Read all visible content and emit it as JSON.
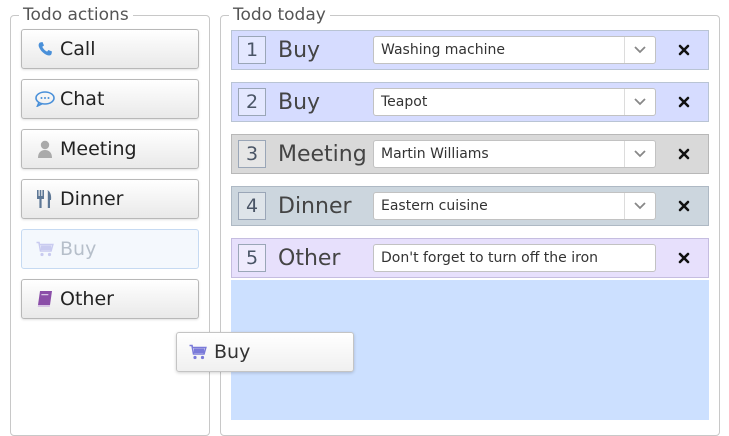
{
  "panels": {
    "actions_title": "Todo actions",
    "today_title": "Todo today"
  },
  "actions": [
    {
      "label": "Call",
      "icon": "phone-icon",
      "color": "#4a90d9"
    },
    {
      "label": "Chat",
      "icon": "speech-bubble-icon",
      "color": "#4a90d9"
    },
    {
      "label": "Meeting",
      "icon": "person-icon",
      "color": "#aaaaaa"
    },
    {
      "label": "Dinner",
      "icon": "fork-knife-icon",
      "color": "#5e7896"
    },
    {
      "label": "Buy",
      "icon": "shopping-cart-icon",
      "color": "#7a7ad9",
      "state": "dragging"
    },
    {
      "label": "Other",
      "icon": "book-icon",
      "color": "#8b4ea8"
    }
  ],
  "todos": [
    {
      "number": "1",
      "kind": "Buy",
      "value": "Washing machine",
      "control": "select",
      "bg": "#d6dcff"
    },
    {
      "number": "2",
      "kind": "Buy",
      "value": "Teapot",
      "control": "select",
      "bg": "#d6dcff"
    },
    {
      "number": "3",
      "kind": "Meeting",
      "value": "Martin Williams",
      "control": "select",
      "bg": "#d9d9d9"
    },
    {
      "number": "4",
      "kind": "Dinner",
      "value": "Eastern cuisine",
      "control": "select",
      "bg": "#ccd6de"
    },
    {
      "number": "5",
      "kind": "Other",
      "value": "Don't forget to turn off the iron",
      "control": "text",
      "bg": "#e7e0fc"
    }
  ],
  "drag_helper": {
    "label": "Buy",
    "icon": "shopping-cart-icon"
  },
  "colors": {
    "drop_zone": "#cce0ff",
    "ghost_border": "#c6daf2"
  }
}
